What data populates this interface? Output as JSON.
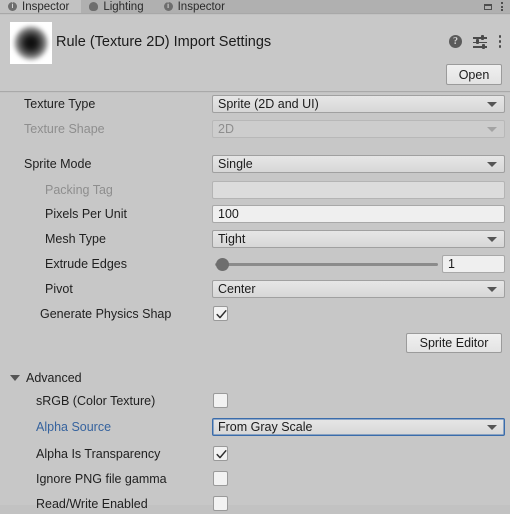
{
  "tabbar": {
    "tabs": [
      {
        "label": "Inspector",
        "icon": "info-icon",
        "active": true
      },
      {
        "label": "Lighting",
        "icon": "bulb-icon",
        "active": false
      },
      {
        "label": "Inspector",
        "icon": "info-icon",
        "active": false
      }
    ],
    "window_controls": [
      {
        "name": "maximize-icon"
      },
      {
        "name": "window-menu-icon"
      }
    ]
  },
  "header": {
    "title": "Rule (Texture 2D) Import Settings",
    "preview_icon": "texture-thumbnail",
    "icons": [
      {
        "name": "help-icon",
        "glyph": "?"
      },
      {
        "name": "preset-icon"
      },
      {
        "name": "more-menu-icon"
      }
    ],
    "open_label": "Open"
  },
  "inspector": {
    "rows": [
      {
        "label": "Texture Type",
        "type": "popup",
        "value": "Sprite (2D and UI)",
        "disabled": false,
        "focused": false
      },
      {
        "label": "Texture Shape",
        "type": "popup",
        "value": "2D",
        "disabled": true,
        "focused": false
      },
      {
        "label": "Sprite Mode",
        "type": "popup",
        "value": "Single",
        "disabled": false,
        "focused": false
      },
      {
        "label": "Packing Tag",
        "type": "text",
        "value": "",
        "disabled": true,
        "focused": false
      },
      {
        "label": "Pixels Per Unit",
        "type": "text",
        "value": "100",
        "disabled": false,
        "focused": false
      },
      {
        "label": "Mesh Type",
        "type": "popup",
        "value": "Tight",
        "disabled": false,
        "focused": false
      },
      {
        "label": "Extrude Edges",
        "type": "slider",
        "value": "1",
        "disabled": false,
        "focused": false
      },
      {
        "label": "Pivot",
        "type": "popup",
        "value": "Center",
        "disabled": false,
        "focused": false
      },
      {
        "label": "Generate Physics Shap",
        "type": "checkbox",
        "value": "checked",
        "disabled": false,
        "focused": false
      }
    ],
    "sprite_editor_label": "Sprite Editor",
    "advanced": {
      "label": "Advanced",
      "expanded": true,
      "rows": [
        {
          "label": "sRGB (Color Texture)",
          "type": "checkbox",
          "value": "unchecked",
          "focused": false
        },
        {
          "label": "Alpha Source",
          "type": "popup",
          "value": "From Gray Scale",
          "focused": true
        },
        {
          "label": "Alpha Is Transparency",
          "type": "checkbox",
          "value": "checked",
          "focused": false
        },
        {
          "label": "Ignore PNG file gamma",
          "type": "checkbox",
          "value": "unchecked",
          "focused": false
        },
        {
          "label": "Read/Write Enabled",
          "type": "checkbox",
          "value": "unchecked",
          "focused": false
        }
      ]
    }
  },
  "colors": {
    "panel_bg": "#c7c7c7",
    "header_bg": "#c8c8c8",
    "accent_blue": "#36639e",
    "field_bg": "#efefef",
    "popup_bg": "#e3e3e3"
  }
}
